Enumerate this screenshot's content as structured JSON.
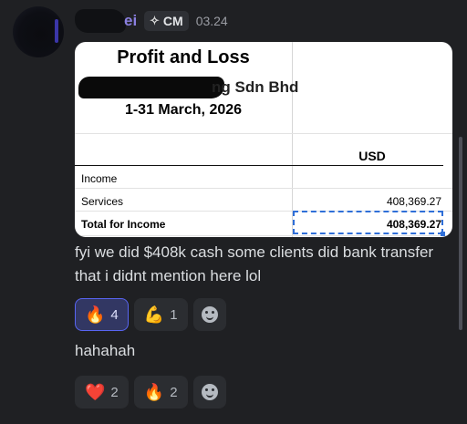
{
  "message": {
    "author_visible_fragment": "ei",
    "tag": {
      "icon": "sparkle-icon",
      "label": "CM"
    },
    "timestamp": "03.24"
  },
  "attachment": {
    "title": "Profit and Loss",
    "company_visible_fragment": "ng Sdn Bhd",
    "period": "1-31 March, 2026",
    "currency": "USD",
    "rows": [
      {
        "label": "Income",
        "value": ""
      },
      {
        "label": "Services",
        "value": "408,369.27"
      },
      {
        "label": "Total for Income",
        "value": "408,369.27"
      }
    ]
  },
  "messages": [
    "fyi we did $408k cash some clients did bank transfer that i didnt mention here lol",
    "hahahah"
  ],
  "reactions": [
    [
      {
        "emoji": "🔥",
        "icon": "fire-emoji",
        "count": "4",
        "active": true
      },
      {
        "emoji": "💪",
        "icon": "flexed-biceps-emoji",
        "count": "1",
        "active": false
      }
    ],
    [
      {
        "emoji": "❤️",
        "icon": "red-heart-emoji",
        "count": "2",
        "active": false
      },
      {
        "emoji": "🔥",
        "icon": "fire-emoji",
        "count": "2",
        "active": false
      }
    ]
  ],
  "colors": {
    "background": "#1f2023",
    "reaction_active_border": "#5865f2",
    "selection_border": "#2f6fd8"
  }
}
